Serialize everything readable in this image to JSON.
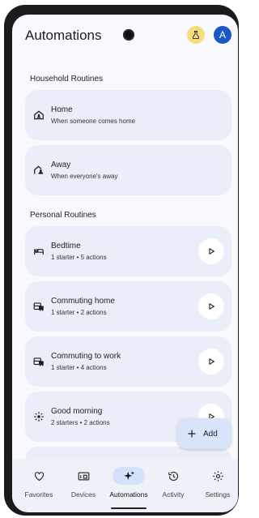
{
  "header": {
    "title": "Automations",
    "labs_icon": "flask-icon",
    "avatar_letter": "A"
  },
  "sections": {
    "household": "Household Routines",
    "personal": "Personal Routines"
  },
  "household_routines": [
    {
      "title": "Home",
      "subtitle": "When someone comes home",
      "icon": "home-person-icon"
    },
    {
      "title": "Away",
      "subtitle": "When everyone's away",
      "icon": "away-person-icon"
    }
  ],
  "personal_routines": [
    {
      "title": "Bedtime",
      "subtitle": "1 starter • 5 actions",
      "icon": "bed-icon"
    },
    {
      "title": "Commuting home",
      "subtitle": "1 starter • 2 actions",
      "icon": "commute-icon"
    },
    {
      "title": "Commuting to work",
      "subtitle": "1 starter • 4 actions",
      "icon": "commute-icon"
    },
    {
      "title": "Good morning",
      "subtitle": "2 starters • 2 actions",
      "icon": "sun-icon"
    }
  ],
  "fab": {
    "label": "Add"
  },
  "nav": [
    {
      "label": "Favorites",
      "icon": "heart-icon"
    },
    {
      "label": "Devices",
      "icon": "devices-icon"
    },
    {
      "label": "Automations",
      "icon": "sparkle-icon",
      "active": true
    },
    {
      "label": "Activity",
      "icon": "history-icon"
    },
    {
      "label": "Settings",
      "icon": "gear-icon"
    }
  ],
  "colors": {
    "card": "#e9eef8",
    "accent": "#d4e1fa",
    "avatar": "#1a56c4",
    "labs": "#f7dc7b"
  }
}
